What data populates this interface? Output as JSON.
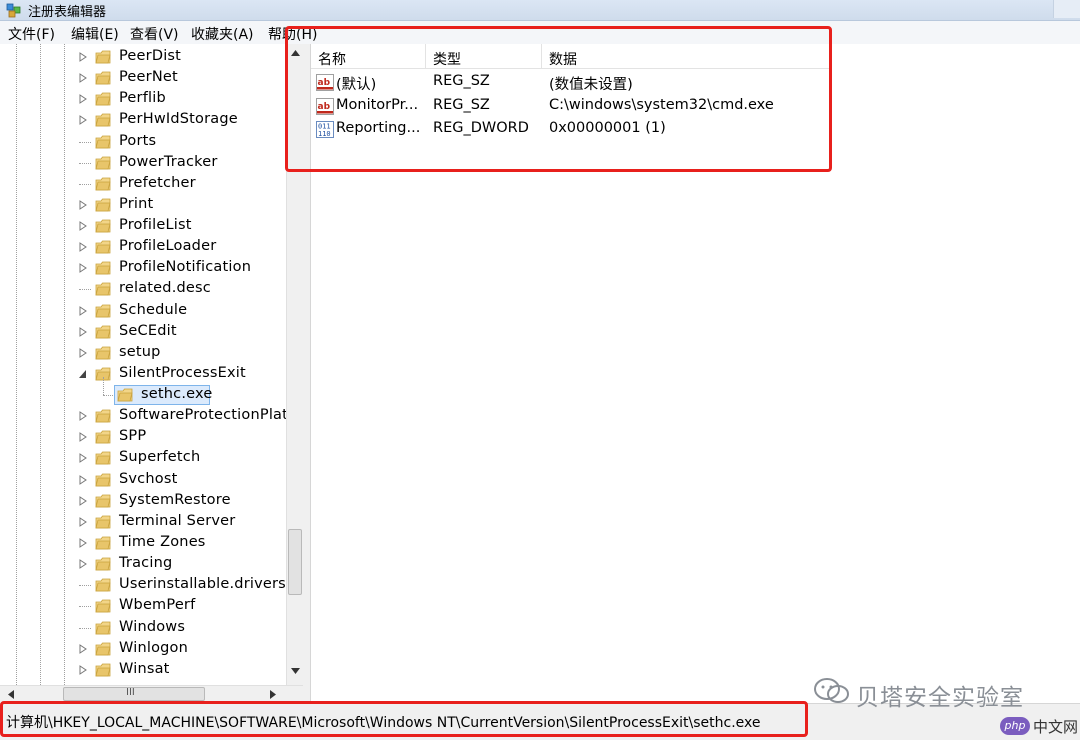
{
  "window": {
    "title": "注册表编辑器"
  },
  "menu": [
    "文件(F)",
    "编辑(E)",
    "查看(V)",
    "收藏夹(A)",
    "帮助(H)"
  ],
  "tree": {
    "items": [
      {
        "label": "PeerDist",
        "expandable": true
      },
      {
        "label": "PeerNet",
        "expandable": true
      },
      {
        "label": "Perflib",
        "expandable": true
      },
      {
        "label": "PerHwIdStorage",
        "expandable": true
      },
      {
        "label": "Ports",
        "expandable": false
      },
      {
        "label": "PowerTracker",
        "expandable": false
      },
      {
        "label": "Prefetcher",
        "expandable": false
      },
      {
        "label": "Print",
        "expandable": true
      },
      {
        "label": "ProfileList",
        "expandable": true
      },
      {
        "label": "ProfileLoader",
        "expandable": true
      },
      {
        "label": "ProfileNotification",
        "expandable": true
      },
      {
        "label": "related.desc",
        "expandable": false
      },
      {
        "label": "Schedule",
        "expandable": true
      },
      {
        "label": "SeCEdit",
        "expandable": true
      },
      {
        "label": "setup",
        "expandable": true
      },
      {
        "label": "SilentProcessExit",
        "expandable": true,
        "expanded": true
      },
      {
        "label": "sethc.exe",
        "child": true,
        "selected": true
      },
      {
        "label": "SoftwareProtectionPlatf",
        "expandable": true
      },
      {
        "label": "SPP",
        "expandable": true
      },
      {
        "label": "Superfetch",
        "expandable": true
      },
      {
        "label": "Svchost",
        "expandable": true
      },
      {
        "label": "SystemRestore",
        "expandable": true
      },
      {
        "label": "Terminal Server",
        "expandable": true
      },
      {
        "label": "Time Zones",
        "expandable": true
      },
      {
        "label": "Tracing",
        "expandable": true
      },
      {
        "label": "Userinstallable.drivers",
        "expandable": false
      },
      {
        "label": "WbemPerf",
        "expandable": false
      },
      {
        "label": "Windows",
        "expandable": false
      },
      {
        "label": "Winlogon",
        "expandable": true
      },
      {
        "label": "Winsat",
        "expandable": true
      }
    ],
    "scroll_grip": "III"
  },
  "values": {
    "columns": [
      "名称",
      "类型",
      "数据"
    ],
    "rows": [
      {
        "name": "(默认)",
        "type": "REG_SZ",
        "data": "(数值未设置)",
        "icon": "string-value-icon"
      },
      {
        "name": "MonitorPr...",
        "type": "REG_SZ",
        "data": "C:\\windows\\system32\\cmd.exe",
        "icon": "string-value-icon"
      },
      {
        "name": "Reporting...",
        "type": "REG_DWORD",
        "data": "0x00000001 (1)",
        "icon": "binary-value-icon"
      }
    ]
  },
  "status": {
    "path": "计算机\\HKEY_LOCAL_MACHINE\\SOFTWARE\\Microsoft\\Windows NT\\CurrentVersion\\SilentProcessExit\\sethc.exe"
  },
  "watermark": {
    "text": "贝塔安全实验室"
  },
  "badge": {
    "logo": "php",
    "text": "中文网"
  },
  "colors": {
    "highlight_box": "#e8201c",
    "selection": "#dbeafc",
    "folder": "#e8c56a"
  }
}
